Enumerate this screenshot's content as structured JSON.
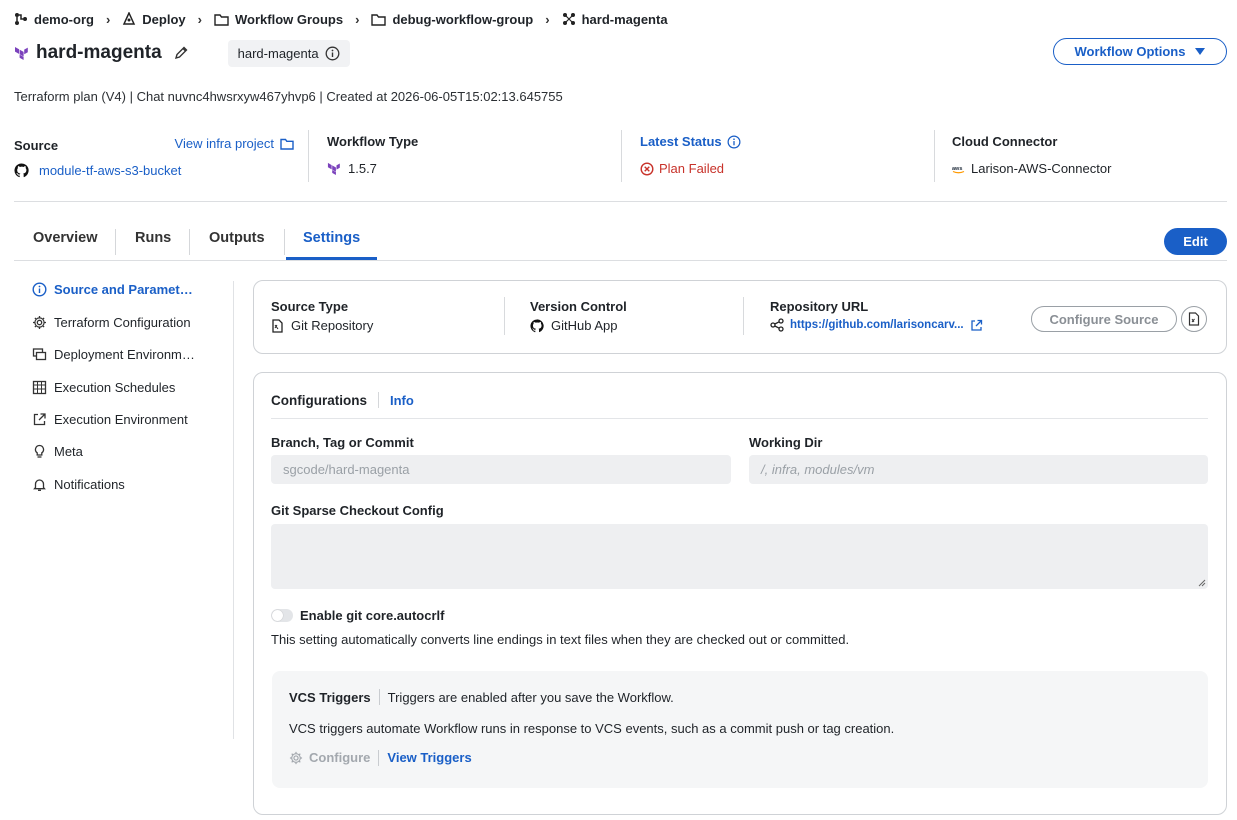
{
  "breadcrumb": [
    {
      "label": "demo-org",
      "icon": "org-tree-icon"
    },
    {
      "label": "Deploy",
      "icon": "deploy-icon"
    },
    {
      "label": "Workflow Groups",
      "icon": "folder-icon"
    },
    {
      "label": "debug-workflow-group",
      "icon": "folder-icon"
    },
    {
      "label": "hard-magenta",
      "icon": "workflow-icon"
    }
  ],
  "header": {
    "title": "hard-magenta",
    "chip": "hard-magenta",
    "options_label": "Workflow Options",
    "meta": "Terraform plan (V4) | Chat nuvnc4hwsrxyw467yhvp6 | Created at 2026-06-05T15:02:13.645755"
  },
  "info": {
    "source_label": "Source",
    "view_infra_label": "View infra project",
    "source_value": "module-tf-aws-s3-bucket",
    "workflow_type_label": "Workflow Type",
    "workflow_type_value": "1.5.7",
    "latest_status_label": "Latest Status",
    "latest_status_value": "Plan Failed",
    "cloud_connector_label": "Cloud Connector",
    "cloud_connector_value": "Larison-AWS-Connector"
  },
  "tabs": [
    "Overview",
    "Runs",
    "Outputs",
    "Settings"
  ],
  "active_tab": "Settings",
  "edit_label": "Edit",
  "sidebar": [
    {
      "label": "Source and Parameters",
      "icon": "info-icon"
    },
    {
      "label": "Terraform Configuration",
      "icon": "gear-icon"
    },
    {
      "label": "Deployment Environment",
      "icon": "deployment-env-icon"
    },
    {
      "label": "Execution Schedules",
      "icon": "calendar-icon"
    },
    {
      "label": "Execution Environment",
      "icon": "external-link-icon"
    },
    {
      "label": "Meta",
      "icon": "lightbulb-icon"
    },
    {
      "label": "Notifications",
      "icon": "bell-icon"
    }
  ],
  "source_card": {
    "source_type_label": "Source Type",
    "source_type_value": "Git Repository",
    "version_control_label": "Version Control",
    "version_control_value": "GitHub App",
    "repo_url_label": "Repository URL",
    "repo_url_value": "https://github.com/larisoncarv...",
    "configure_source_label": "Configure Source"
  },
  "config": {
    "tab_configurations": "Configurations",
    "tab_info": "Info",
    "branch_label": "Branch, Tag or Commit",
    "branch_placeholder": "sgcode/hard-magenta",
    "working_dir_label": "Working Dir",
    "working_dir_placeholder": "/, infra, modules/vm",
    "sparse_label": "Git Sparse Checkout Config",
    "autocrlf_label": "Enable git core.autocrlf",
    "autocrlf_enabled": false,
    "autocrlf_desc": "This setting automatically converts line endings in text files when they are checked out or committed.",
    "vcs_title": "VCS Triggers",
    "vcs_note": "Triggers are enabled after you save the Workflow.",
    "vcs_desc": "VCS triggers automate Workflow runs in response to VCS events, such as a commit push or tag creation.",
    "vcs_configure": "Configure",
    "vcs_view": "View Triggers"
  },
  "colors": {
    "accent": "#1a5fc7",
    "error": "#c8322a",
    "terraform": "#7b42bc"
  }
}
